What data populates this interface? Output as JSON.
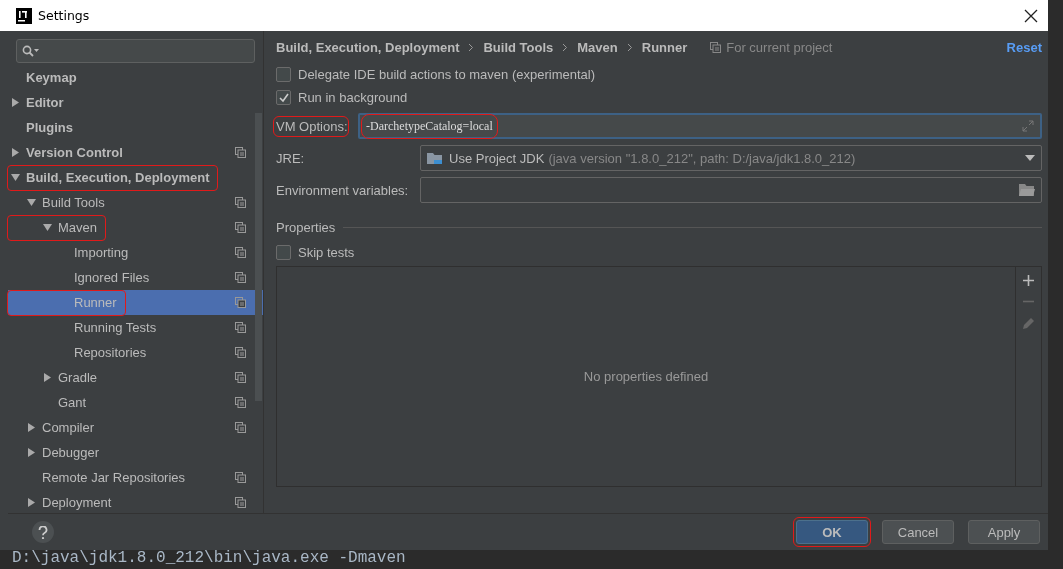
{
  "window": {
    "title": "Settings"
  },
  "tree": [
    {
      "label": "Keymap",
      "selected": false,
      "highlighted": false,
      "project_scope": false
    },
    {
      "label": "Editor",
      "expanded": false,
      "selected": false,
      "highlighted": false,
      "project_scope": false
    },
    {
      "label": "Plugins",
      "selected": false,
      "highlighted": false,
      "project_scope": false
    },
    {
      "label": "Version Control",
      "expanded": false,
      "selected": false,
      "highlighted": false,
      "project_scope": true
    },
    {
      "label": "Build, Execution, Deployment",
      "expanded": true,
      "selected": false,
      "highlighted": true,
      "project_scope": false,
      "children": [
        {
          "label": "Build Tools",
          "expanded": true,
          "selected": false,
          "highlighted": false,
          "project_scope": true,
          "children": [
            {
              "label": "Maven",
              "expanded": true,
              "selected": false,
              "highlighted": true,
              "project_scope": true,
              "children": [
                {
                  "label": "Importing",
                  "selected": false,
                  "highlighted": false,
                  "project_scope": true
                },
                {
                  "label": "Ignored Files",
                  "selected": false,
                  "highlighted": false,
                  "project_scope": true
                },
                {
                  "label": "Runner",
                  "selected": true,
                  "highlighted": true,
                  "project_scope": true
                },
                {
                  "label": "Running Tests",
                  "selected": false,
                  "highlighted": false,
                  "project_scope": true
                },
                {
                  "label": "Repositories",
                  "selected": false,
                  "highlighted": false,
                  "project_scope": true
                }
              ]
            },
            {
              "label": "Gradle",
              "expanded": false,
              "selected": false,
              "highlighted": false,
              "project_scope": true
            },
            {
              "label": "Gant",
              "selected": false,
              "highlighted": false,
              "project_scope": true
            }
          ]
        },
        {
          "label": "Compiler",
          "expanded": false,
          "selected": false,
          "highlighted": false,
          "project_scope": true
        },
        {
          "label": "Debugger",
          "expanded": false,
          "selected": false,
          "highlighted": false,
          "project_scope": false
        },
        {
          "label": "Remote Jar Repositories",
          "selected": false,
          "highlighted": false,
          "project_scope": true
        },
        {
          "label": "Deployment",
          "expanded": false,
          "selected": false,
          "highlighted": false,
          "project_scope": true
        }
      ]
    }
  ],
  "breadcrumb": [
    "Build, Execution, Deployment",
    "Build Tools",
    "Maven",
    "Runner"
  ],
  "scope_note": "For current project",
  "reset": "Reset",
  "checkboxes": [
    {
      "label": "Delegate IDE build actions to maven (experimental)",
      "checked": false
    },
    {
      "label": "Run in background",
      "checked": true
    }
  ],
  "vm_options": {
    "label": "VM Options:",
    "value": "-DarchetypeCatalog=local",
    "highlighted": true
  },
  "jre": {
    "label": "JRE:",
    "value": "Use Project JDK",
    "detail": "(java version \"1.8.0_212\", path: D:/java/jdk1.8.0_212)"
  },
  "env": {
    "label": "Environment variables:"
  },
  "properties": {
    "title": "Properties",
    "skip_tests": {
      "label": "Skip tests",
      "checked": false
    },
    "empty_text": "No properties defined"
  },
  "buttons": [
    {
      "label": "OK",
      "kind": "primary",
      "highlighted": true
    },
    {
      "label": "Cancel",
      "kind": "normal",
      "highlighted": false
    },
    {
      "label": "Apply",
      "kind": "normal",
      "highlighted": false
    }
  ],
  "background_console": "D:\\java\\jdk1.8.0_212\\bin\\java.exe -Dmaven"
}
